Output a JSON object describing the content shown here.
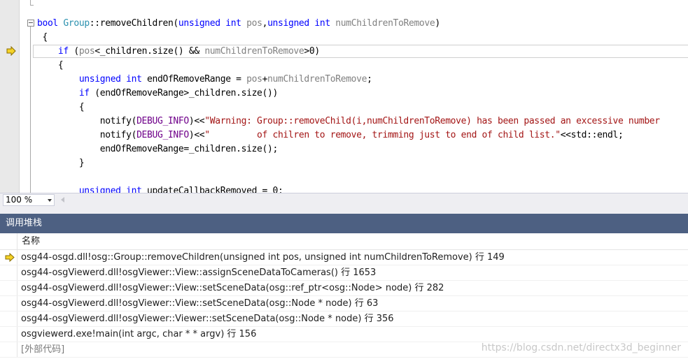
{
  "editor": {
    "lines": [
      [
        {
          "t": "bool",
          "c": "kw"
        },
        {
          "t": " "
        },
        {
          "t": "Group",
          "c": "ty"
        },
        {
          "t": "::removeChildren("
        },
        {
          "t": "unsigned",
          "c": "kw"
        },
        {
          "t": " "
        },
        {
          "t": "int",
          "c": "kw"
        },
        {
          "t": " "
        },
        {
          "t": "pos",
          "c": "pr"
        },
        {
          "t": ","
        },
        {
          "t": "unsigned",
          "c": "kw"
        },
        {
          "t": " "
        },
        {
          "t": "int",
          "c": "kw"
        },
        {
          "t": " "
        },
        {
          "t": "numChildrenToRemove",
          "c": "pr"
        },
        {
          "t": ")"
        }
      ],
      [
        {
          "t": " {"
        }
      ],
      [
        {
          "t": "    "
        },
        {
          "t": "if",
          "c": "kw"
        },
        {
          "t": " ("
        },
        {
          "t": "pos",
          "c": "pr"
        },
        {
          "t": "<_children.size() && "
        },
        {
          "t": "numChildrenToRemove",
          "c": "pr"
        },
        {
          "t": ">0)"
        }
      ],
      [
        {
          "t": "    {"
        }
      ],
      [
        {
          "t": "        "
        },
        {
          "t": "unsigned",
          "c": "kw"
        },
        {
          "t": " "
        },
        {
          "t": "int",
          "c": "kw"
        },
        {
          "t": " endOfRemoveRange = "
        },
        {
          "t": "pos",
          "c": "pr"
        },
        {
          "t": "+"
        },
        {
          "t": "numChildrenToRemove",
          "c": "pr"
        },
        {
          "t": ";"
        }
      ],
      [
        {
          "t": "        "
        },
        {
          "t": "if",
          "c": "kw"
        },
        {
          "t": " (endOfRemoveRange>_children.size())"
        }
      ],
      [
        {
          "t": "        {"
        }
      ],
      [
        {
          "t": "            notify("
        },
        {
          "t": "DEBUG_INFO",
          "c": "mac"
        },
        {
          "t": ")<<"
        },
        {
          "t": "\"Warning: Group::removeChild(i,numChildrenToRemove) has been passed an excessive number",
          "c": "st"
        }
      ],
      [
        {
          "t": "            notify("
        },
        {
          "t": "DEBUG_INFO",
          "c": "mac"
        },
        {
          "t": ")<<"
        },
        {
          "t": "\"         of chilren to remove, trimming just to end of child list.\"",
          "c": "st"
        },
        {
          "t": "<<std::endl;"
        }
      ],
      [
        {
          "t": "            endOfRemoveRange=_children.size();"
        }
      ],
      [
        {
          "t": "        }"
        }
      ],
      [
        {
          "t": ""
        }
      ],
      [
        {
          "t": "        "
        },
        {
          "t": "unsigned",
          "c": "kw"
        },
        {
          "t": " "
        },
        {
          "t": "int",
          "c": "kw"
        },
        {
          "t": " updateCallbackRemoved = 0;"
        }
      ]
    ]
  },
  "zoom": {
    "value": "100 %"
  },
  "call_stack": {
    "title": "调用堆栈",
    "column_name": "名称",
    "rows": [
      {
        "text": "osg44-osgd.dll!osg::Group::removeChildren(unsigned int pos, unsigned int numChildrenToRemove) 行 149",
        "current": true
      },
      {
        "text": "osg44-osgViewerd.dll!osgViewer::View::assignSceneDataToCameras() 行 1653"
      },
      {
        "text": "osg44-osgViewerd.dll!osgViewer::View::setSceneData(osg::ref_ptr<osg::Node> node) 行 282"
      },
      {
        "text": "osg44-osgViewerd.dll!osgViewer::View::setSceneData(osg::Node * node) 行 63"
      },
      {
        "text": "osg44-osgViewerd.dll!osgViewer::Viewer::setSceneData(osg::Node * node) 行 356"
      },
      {
        "text": "osgviewerd.exe!main(int argc, char * * argv) 行 156"
      },
      {
        "text": "[外部代码]",
        "external": true
      }
    ]
  },
  "watermark": "https://blog.csdn.net/directx3d_beginner",
  "colors": {
    "keyword": "#0000ff",
    "type": "#2b91af",
    "param": "#808080",
    "string": "#a31515",
    "macro": "#6f008a",
    "panel_title_bg": "#4d6082",
    "arrow": "#f5d327"
  }
}
